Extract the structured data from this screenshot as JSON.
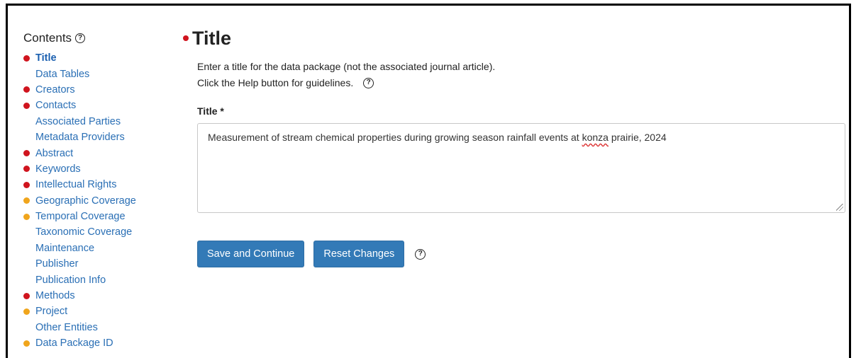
{
  "sidebar": {
    "heading": "Contents",
    "help_icon": "help-circle-icon",
    "items": [
      {
        "label": "Title",
        "status": "red",
        "active": true
      },
      {
        "label": "Data Tables",
        "status": "none"
      },
      {
        "label": "Creators",
        "status": "red"
      },
      {
        "label": "Contacts",
        "status": "red"
      },
      {
        "label": "Associated Parties",
        "status": "none"
      },
      {
        "label": "Metadata Providers",
        "status": "none"
      },
      {
        "label": "Abstract",
        "status": "red"
      },
      {
        "label": "Keywords",
        "status": "red"
      },
      {
        "label": "Intellectual Rights",
        "status": "red"
      },
      {
        "label": "Geographic Coverage",
        "status": "orange"
      },
      {
        "label": "Temporal Coverage",
        "status": "orange"
      },
      {
        "label": "Taxonomic Coverage",
        "status": "none"
      },
      {
        "label": "Maintenance",
        "status": "none"
      },
      {
        "label": "Publisher",
        "status": "none"
      },
      {
        "label": "Publication Info",
        "status": "none"
      },
      {
        "label": "Methods",
        "status": "red"
      },
      {
        "label": "Project",
        "status": "orange"
      },
      {
        "label": "Other Entities",
        "status": "none"
      },
      {
        "label": "Data Package ID",
        "status": "orange"
      }
    ]
  },
  "colors": {
    "red": "#d0141e",
    "orange": "#f0a51c",
    "link": "#2a6fb5",
    "button": "#337ab7"
  },
  "main": {
    "title": "Title",
    "title_status": "red",
    "description_line1": "Enter a title for the data package (not the associated journal article).",
    "description_line2": "Click the Help button for guidelines.",
    "field_label": "Title *",
    "field_value_before": "Measurement of stream chemical properties during growing season rainfall events at ",
    "field_value_misspelled": "konza",
    "field_value_after": " prairie, 2024",
    "save_button": "Save and Continue",
    "reset_button": "Reset Changes"
  }
}
